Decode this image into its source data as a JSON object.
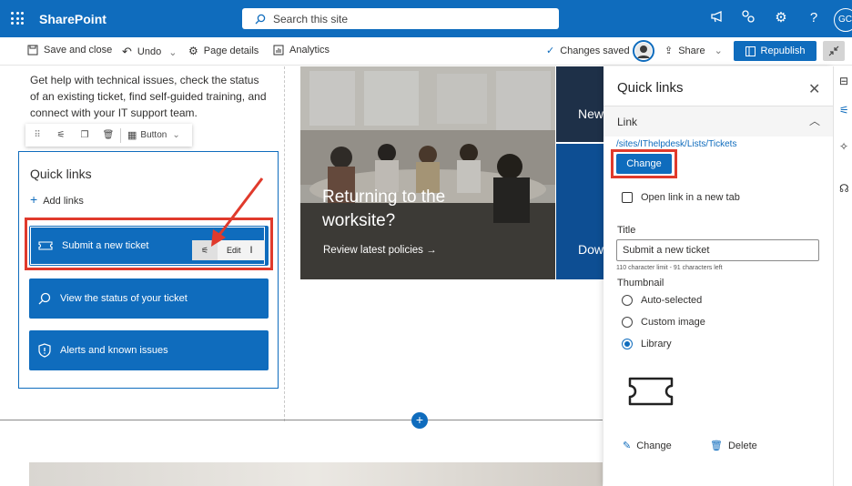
{
  "topbar": {
    "app_name": "SharePoint",
    "search_placeholder": "Search this site",
    "avatar_initials": "GC",
    "help": "?"
  },
  "cmdbar": {
    "save_close": "Save and close",
    "undo": "Undo",
    "page_details": "Page details",
    "analytics": "Analytics",
    "status": "Changes saved",
    "share": "Share",
    "republish": "Republish"
  },
  "content": {
    "intro": "Get help with technical issues, check the status of an existing ticket, find self-guided training, and connect with your IT support team.",
    "toolbar_button_label": "Button",
    "quick_links_title": "Quick links",
    "add_links": "Add links",
    "buttons": [
      {
        "label": "Submit a new ticket",
        "icon": "ticket-icon"
      },
      {
        "label": "View the status of your ticket",
        "icon": "search-icon"
      },
      {
        "label": "Alerts and known issues",
        "icon": "shield-alert-icon"
      }
    ],
    "edit_label": "Edit"
  },
  "hero": {
    "title": "Returning to the worksite?",
    "link": "Review latest policies →",
    "tile2_text": "New",
    "tile3_text": "Dow"
  },
  "panel": {
    "title": "Quick links",
    "section": "Link",
    "url": "/sites/IThelpdesk/Lists/Tickets",
    "change_button": "Change",
    "new_tab_label": "Open link in a new tab",
    "title_label": "Title",
    "title_value": "Submit a new ticket",
    "char_limit": "110 character limit - 91 characters left",
    "thumbnail_label": "Thumbnail",
    "thumbnail_options": [
      "Auto-selected",
      "Custom image",
      "Library"
    ],
    "thumbnail_selected": "Library",
    "change_link": "Change",
    "delete_link": "Delete"
  },
  "colors": {
    "brand": "#0f6cbd",
    "highlight": "#e03a2c"
  }
}
